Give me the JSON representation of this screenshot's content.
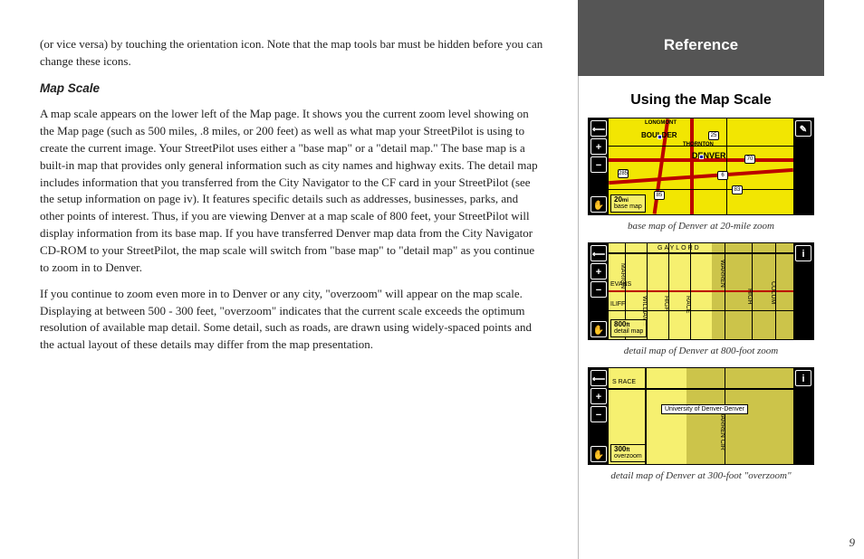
{
  "main": {
    "intro_continued": "(or vice versa) by touching the orientation icon. Note that the map tools bar must be hidden before you can change these icons.",
    "subheading": "Map Scale",
    "para1": "A map scale appears on the lower left of the Map page. It shows you the current zoom level showing on the Map page (such as 500 miles, .8 miles, or 200 feet) as well as what map your StreetPilot is using to create the current image. Your StreetPilot uses either a \"base map\" or a \"detail map.\" The base map is a built-in map that provides only general information such as city names and highway exits. The detail map includes information that you transferred from the City Navigator  to the CF card in your StreetPilot (see the setup information on page iv). It features specific details such as addresses, businesses, parks, and other points of interest. Thus, if you are viewing Denver at a map scale of 800 feet, your StreetPilot will display information from its base map. If you have transferred Denver map data from the City Navigator CD-ROM to your StreetPilot, the map scale will switch from \"base map\" to \"detail map\" as you continue to zoom in to Denver.",
    "para2": "If you continue to zoom even more in to Denver or any city, \"overzoom\" will appear on the map scale. Displaying at between 500 - 300 feet, \"overzoom\" indicates that the current scale exceeds the optimum resolution of available map detail. Some detail, such as roads, are drawn using widely-spaced points and the actual layout of these details may differ from the map presentation."
  },
  "sidebar": {
    "ref_title": "Reference",
    "section_title": "Using the Map Scale",
    "fig1": {
      "caption": "base map of Denver at 20-mile zoom",
      "scale_value": "20",
      "scale_unit": "mi",
      "scale_label": "base map",
      "city1": "BOULDER",
      "city2": "DENVER",
      "city3": "LONGMONT",
      "city4": "THORNTON"
    },
    "fig2": {
      "caption": "detail map of Denver at 800-foot zoom",
      "scale_value": "800",
      "scale_unit": "ft",
      "scale_label": "detail map",
      "st1": "GAYLORD",
      "st2": "WILLIAMS",
      "st3": "HIGH",
      "st4": "RACE",
      "st5": "MARION",
      "st6": "COLUM",
      "st7": "EVANS",
      "st8": "ILIFF",
      "st9": "WARREN"
    },
    "fig3": {
      "caption": "detail map of Denver at 300-foot \"overzoom\"",
      "scale_value": "300",
      "scale_unit": "ft",
      "scale_label": "overzoom",
      "st1": "S RACE",
      "st2": "WARREN CIR",
      "univ": "University of Denver-Denver"
    }
  },
  "page_number": "9",
  "icons": {
    "back": "back-arrow",
    "zoom_in": "zoom-in",
    "zoom_out": "zoom-out",
    "hand": "pan-hand",
    "pencil": "pencil",
    "info": "info"
  }
}
